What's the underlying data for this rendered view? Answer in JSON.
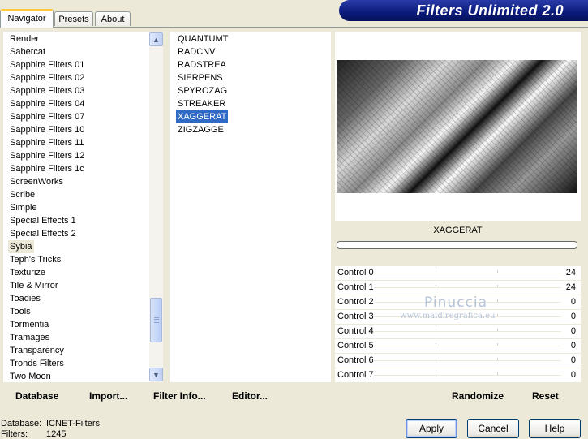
{
  "tabs": [
    "Navigator",
    "Presets",
    "About"
  ],
  "app_title": "Filters Unlimited 2.0",
  "categories": [
    "Render",
    "Sabercat",
    "Sapphire Filters 01",
    "Sapphire Filters 02",
    "Sapphire Filters 03",
    "Sapphire Filters 04",
    "Sapphire Filters 07",
    "Sapphire Filters 10",
    "Sapphire Filters 11",
    "Sapphire Filters 12",
    "Sapphire Filters 1c",
    "ScreenWorks",
    "Scribe",
    "Simple",
    "Special Effects 1",
    "Special Effects 2",
    "Sybia",
    "Teph's Tricks",
    "Texturize",
    "Tile & Mirror",
    "Toadies",
    "Tools",
    "Tormentia",
    "Tramages",
    "Transparency",
    "Tronds Filters",
    "Two Moon"
  ],
  "selected_category": "Sybia",
  "filters": [
    "QUANTUMT",
    "RADCNV",
    "RADSTREA",
    "SIERPENS",
    "SPYROZAG",
    "STREAKER",
    "XAGGERAT",
    "ZIGZAGGE"
  ],
  "selected_filter": "XAGGERAT",
  "toolbar": {
    "database": "Database",
    "import": "Import...",
    "filter_info": "Filter Info...",
    "editor": "Editor...",
    "randomize": "Randomize",
    "reset": "Reset"
  },
  "preview": {
    "filter_name": "XAGGERAT"
  },
  "controls": [
    {
      "label": "Control 0",
      "value": "24"
    },
    {
      "label": "Control 1",
      "value": "24"
    },
    {
      "label": "Control 2",
      "value": "0"
    },
    {
      "label": "Control 3",
      "value": "0"
    },
    {
      "label": "Control 4",
      "value": "0"
    },
    {
      "label": "Control 5",
      "value": "0"
    },
    {
      "label": "Control 6",
      "value": "0"
    },
    {
      "label": "Control 7",
      "value": "0"
    }
  ],
  "watermark": {
    "name": "Pinuccia",
    "site": "www.maidiregrafica.eu"
  },
  "status": {
    "database_label": "Database:",
    "database_value": "ICNET-Filters",
    "filters_label": "Filters:",
    "filters_value": "1245"
  },
  "buttons": {
    "apply": "Apply",
    "cancel": "Cancel",
    "help": "Help"
  }
}
